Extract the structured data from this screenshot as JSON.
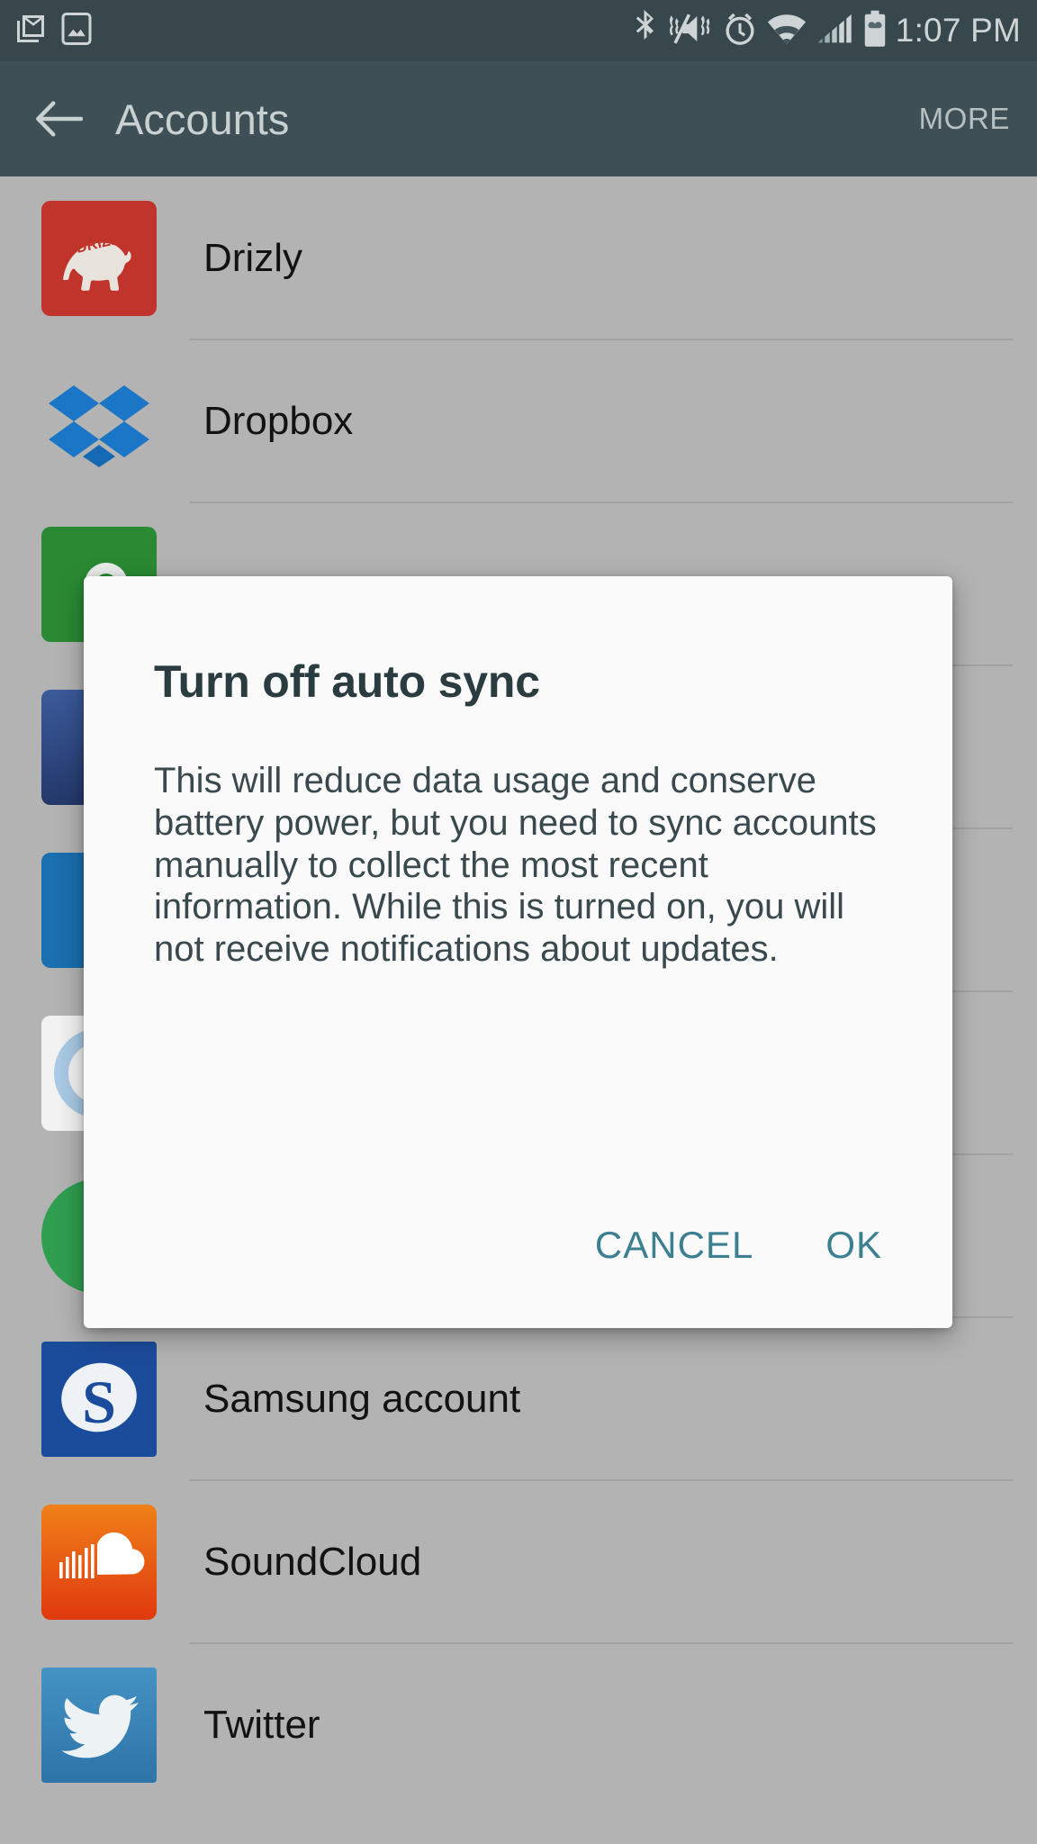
{
  "status_bar": {
    "time": "1:07 PM",
    "left_icons": [
      {
        "name": "gmail-icon"
      },
      {
        "name": "screenshot-image-icon"
      }
    ],
    "right_icons": [
      {
        "name": "bluetooth-icon"
      },
      {
        "name": "mute-vibrate-icon"
      },
      {
        "name": "alarm-clock-icon"
      },
      {
        "name": "wifi-icon"
      },
      {
        "name": "cellular-signal-icon"
      },
      {
        "name": "battery-icon"
      }
    ]
  },
  "app_bar": {
    "back_label": "back-arrow-icon",
    "title": "Accounts",
    "more_label": "MORE"
  },
  "accounts": [
    {
      "label": "Drizly",
      "icon": "drizly-icon"
    },
    {
      "label": "Dropbox",
      "icon": "dropbox-icon"
    },
    {
      "label": "",
      "icon": "green-app-icon"
    },
    {
      "label": "",
      "icon": "navy-app-icon"
    },
    {
      "label": "",
      "icon": "blue-app-icon"
    },
    {
      "label": "",
      "icon": "ring-app-icon"
    },
    {
      "label": "",
      "icon": "green-circle-app-icon"
    },
    {
      "label": "Samsung account",
      "icon": "samsung-account-icon"
    },
    {
      "label": "SoundCloud",
      "icon": "soundcloud-icon"
    },
    {
      "label": "Twitter",
      "icon": "twitter-icon"
    }
  ],
  "dialog": {
    "title": "Turn off auto sync",
    "body": "This will reduce data usage and conserve battery power, but you need to sync accounts manually to collect the most recent information. While this is turned on, you will not receive notifications about updates.",
    "cancel_label": "CANCEL",
    "ok_label": "OK"
  },
  "colors": {
    "status_bar": "#37474b",
    "app_bar": "#3e5055",
    "page_background": "#b3b3b3",
    "dialog_surface": "#fafafa",
    "dialog_accent": "#3b7f91",
    "divider": "#a2a2a2"
  }
}
